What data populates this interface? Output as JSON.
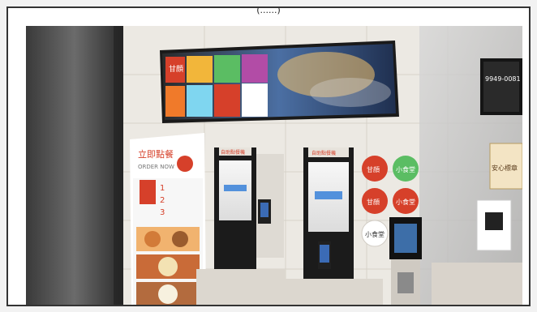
{
  "image": {
    "caption_fragment": "(......)",
    "signage": {
      "menu_board_brand": "甘顔",
      "poster_title": "立即點餐",
      "poster_subtitle": "ORDER NOW",
      "poster_steps": [
        "1",
        "2",
        "3"
      ],
      "kiosk_header_left": "自助點餐機",
      "kiosk_header_right": "自助點餐機",
      "right_screen_number": "9949-0081",
      "badge_texts": [
        "甘顔",
        "小食堂",
        "甘顔",
        "小食堂",
        "小食堂"
      ],
      "pinned_notice": "安心標章"
    }
  },
  "colors": {
    "background": "#ffffff",
    "frame_border": "#333333",
    "wall": "#e9e6e0",
    "poster_red": "#d6402a",
    "kiosk_black": "#1b1b1b",
    "screen_blue": "#2d7bd8"
  }
}
